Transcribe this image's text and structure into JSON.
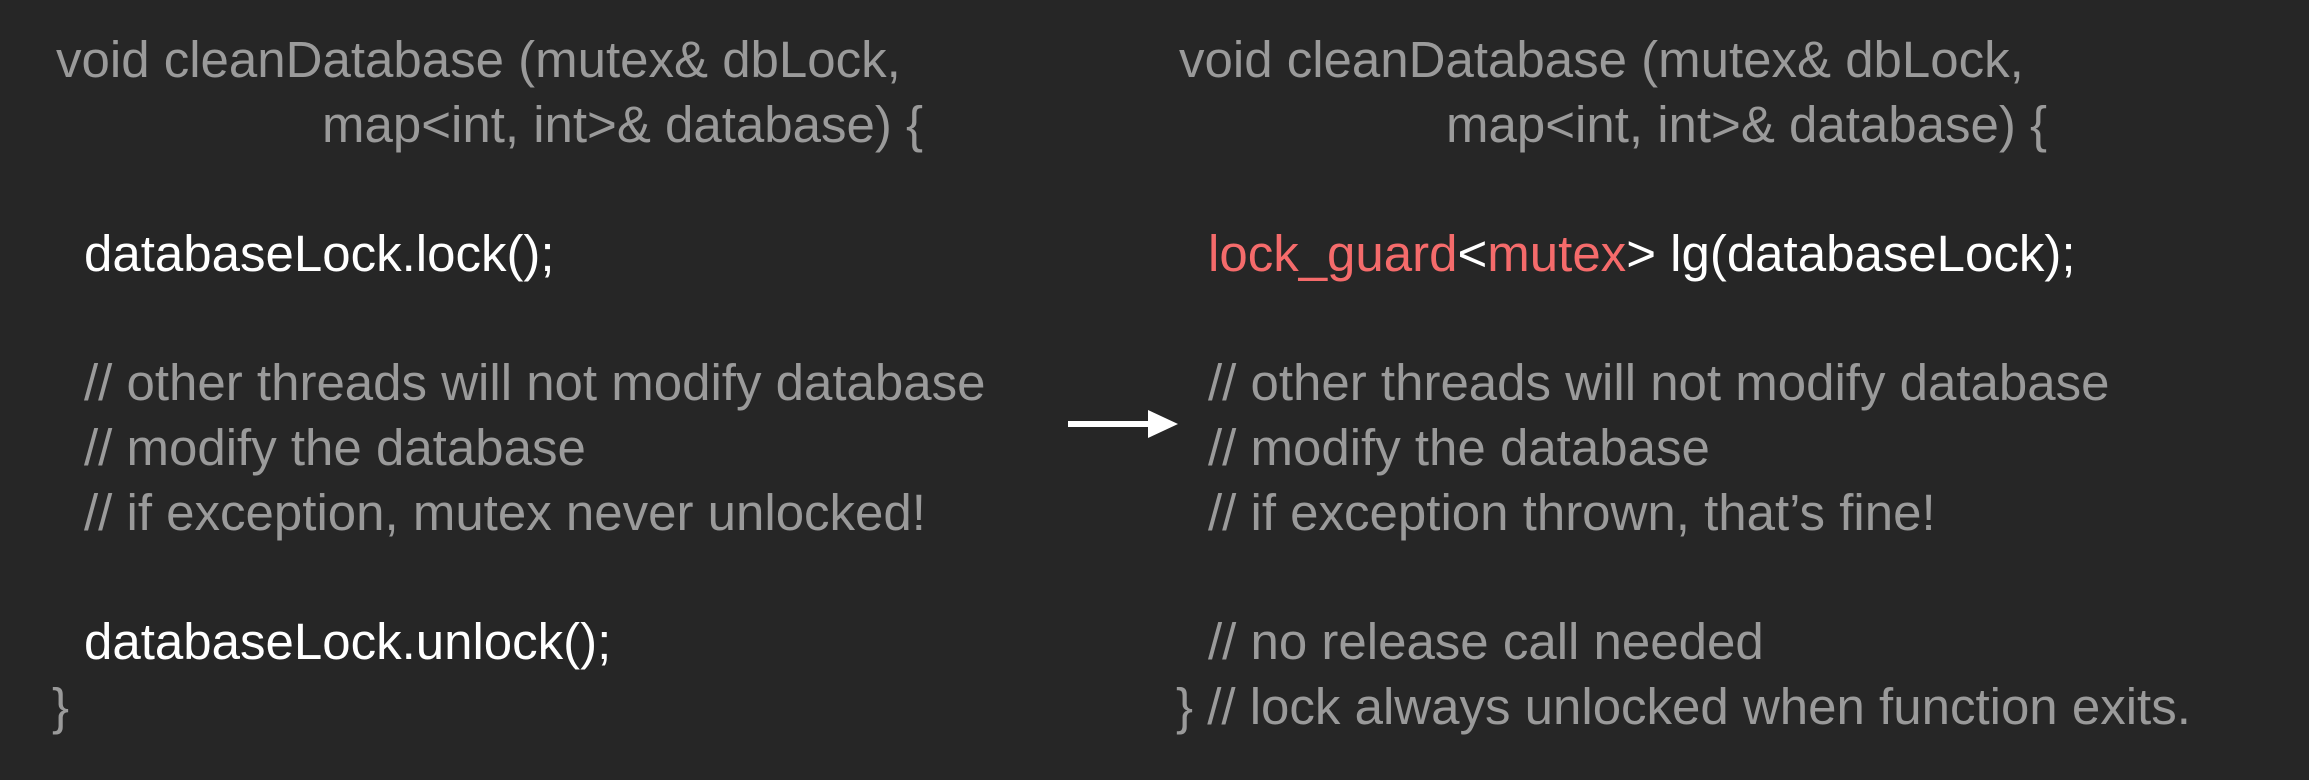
{
  "left": {
    "signature_1": "void cleanDatabase (mutex& dbLock,",
    "signature_2": "map<int, int>& database) {",
    "lock_call": "databaseLock.lock();",
    "comment_1": "// other threads will not modify database",
    "comment_2": "// modify the database",
    "comment_3": "// if exception, mutex never unlocked!",
    "unlock_call": "databaseLock.unlock();",
    "close_brace": "}"
  },
  "right": {
    "signature_1": "void cleanDatabase (mutex& dbLock,",
    "signature_2": "map<int, int>& database) {",
    "guard_type": "lock_guard",
    "guard_lt": "<",
    "guard_param": "mutex",
    "guard_rest": "> lg(databaseLock);",
    "comment_1": "// other threads will not modify database",
    "comment_2": "// modify the database",
    "comment_3": "// if exception thrown, that’s fine!",
    "comment_4": "// no release call needed",
    "close_line": "} // lock always unlocked when function exits."
  },
  "colors": {
    "background": "#262626",
    "comment": "#9a9a9a",
    "code": "#ffffff",
    "keyword": "#f56b6b"
  },
  "icons": {
    "transition": "right-arrow-icon"
  }
}
